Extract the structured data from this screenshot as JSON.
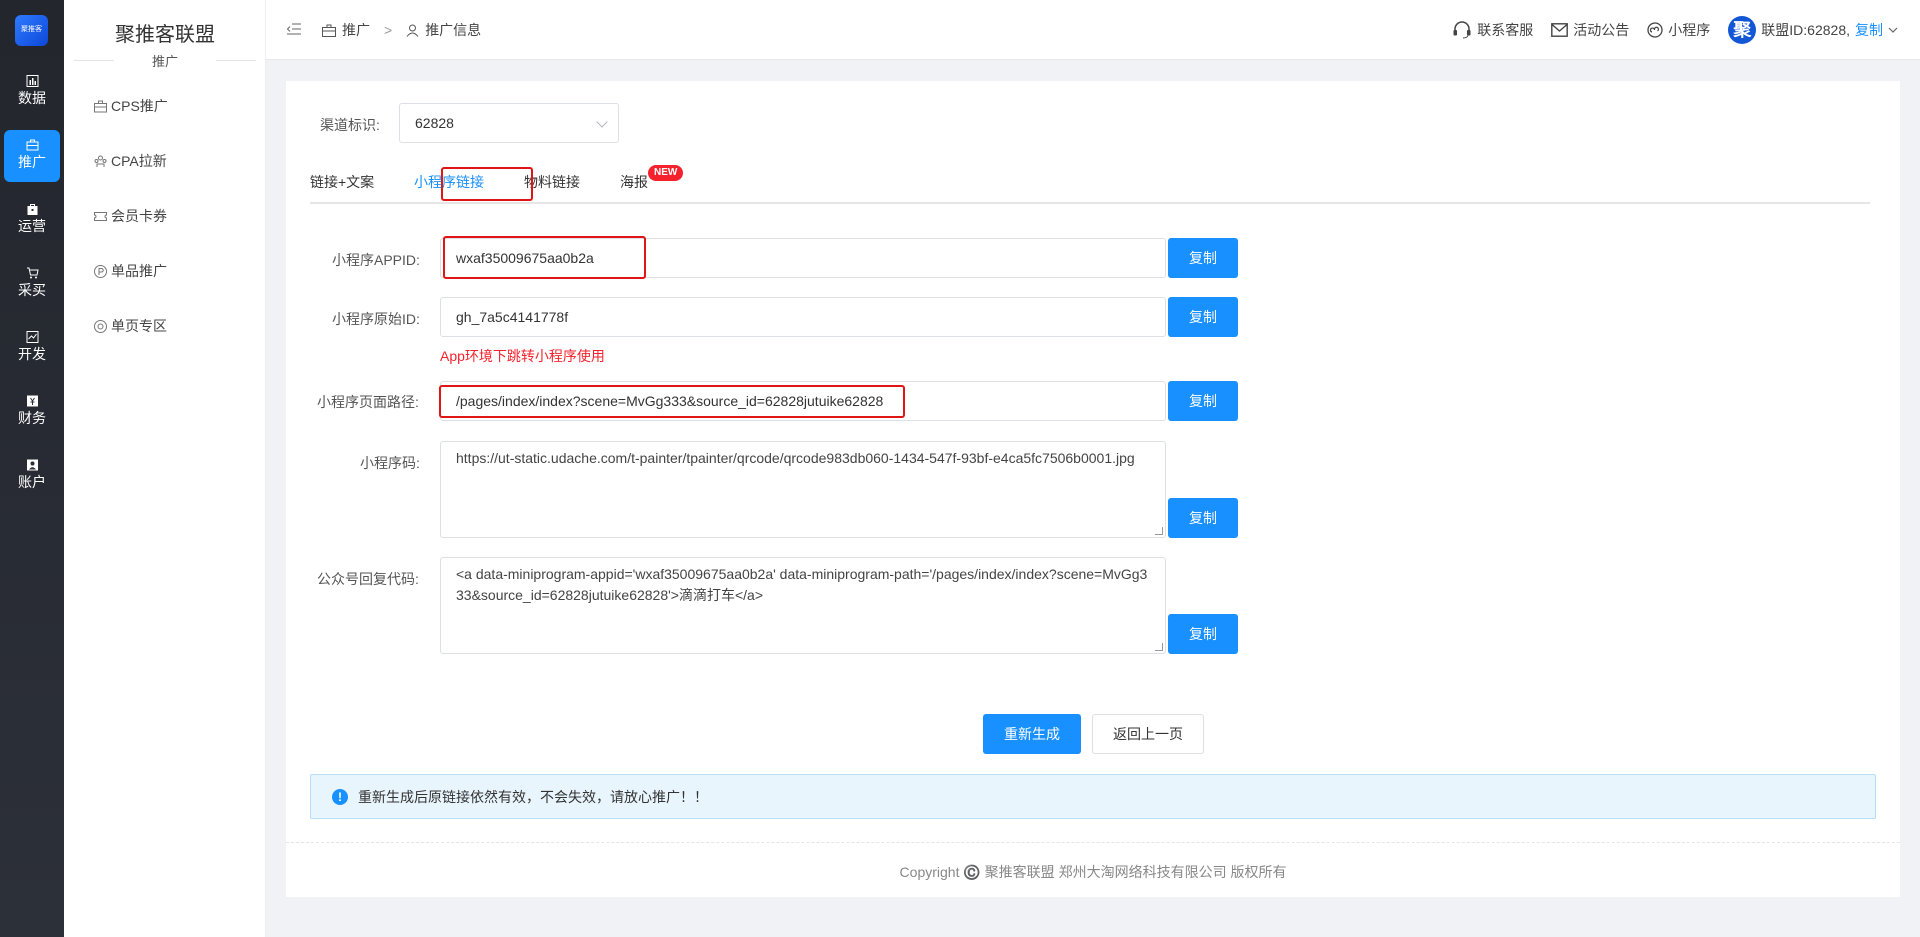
{
  "rail": {
    "logo_text": "聚推客",
    "items": [
      {
        "label": "数据",
        "icon": "bar-chart-icon"
      },
      {
        "label": "推广",
        "icon": "briefcase-icon"
      },
      {
        "label": "运营",
        "icon": "bag-icon"
      },
      {
        "label": "采买",
        "icon": "cart-icon"
      },
      {
        "label": "开发",
        "icon": "code-chart-icon"
      },
      {
        "label": "财务",
        "icon": "yen-icon"
      },
      {
        "label": "账户",
        "icon": "person-card-icon"
      }
    ],
    "active_index": 1
  },
  "sidebar": {
    "title": "聚推客联盟",
    "subtitle": "推广",
    "items": [
      {
        "label": "CPS推广",
        "icon": "briefcase-icon"
      },
      {
        "label": "CPA拉新",
        "icon": "users-icon"
      },
      {
        "label": "会员卡券",
        "icon": "ticket-icon"
      },
      {
        "label": "单品推广",
        "icon": "p-circle-icon"
      },
      {
        "label": "单页专区",
        "icon": "target-icon"
      }
    ]
  },
  "header": {
    "breadcrumb": [
      "推广",
      "推广信息"
    ],
    "breadcrumb_sep": ">",
    "links": {
      "service": "联系客服",
      "notice": "活动公告",
      "mini": "小程序"
    },
    "avatar": "聚",
    "union_id": "联盟ID:62828,",
    "copy": "复制"
  },
  "form": {
    "channel_label": "渠道标识:",
    "channel_value": "62828",
    "tabs": [
      "链接+文案",
      "小程序链接",
      "物料链接",
      "海报"
    ],
    "tab_badge": "NEW",
    "active_tab": 1,
    "fields": {
      "appid_label": "小程序APPID:",
      "appid_value": "wxaf35009675aa0b2a",
      "origid_label": "小程序原始ID:",
      "origid_value": "gh_7a5c4141778f",
      "origid_hint": "App环境下跳转小程序使用",
      "path_label": "小程序页面路径:",
      "path_value": "/pages/index/index?scene=MvGg333&source_id=62828jutuike62828",
      "qrcode_label": "小程序码:",
      "qrcode_value": "https://ut-static.udache.com/t-painter/tpainter/qrcode/qrcode983db060-1434-547f-93bf-e4ca5fc7506b0001.jpg",
      "reply_label": "公众号回复代码:",
      "reply_value": "<a data-miniprogram-appid='wxaf35009675aa0b2a' data-miniprogram-path='/pages/index/index?scene=MvGg333&source_id=62828jutuike62828'>滴滴打车</a>"
    },
    "copy_label": "复制",
    "regenerate": "重新生成",
    "back": "返回上一页",
    "alert": "重新生成后原链接依然有效，不会失效，请放心推广！！"
  },
  "footer": {
    "copyright": "Copyright ©️ 聚推客联盟 郑州大淘网络科技有限公司 版权所有"
  },
  "colors": {
    "primary": "#1890ff",
    "highlight_box": "#e01515",
    "hint": "#f5222d",
    "rail_bg": "#23262d"
  }
}
